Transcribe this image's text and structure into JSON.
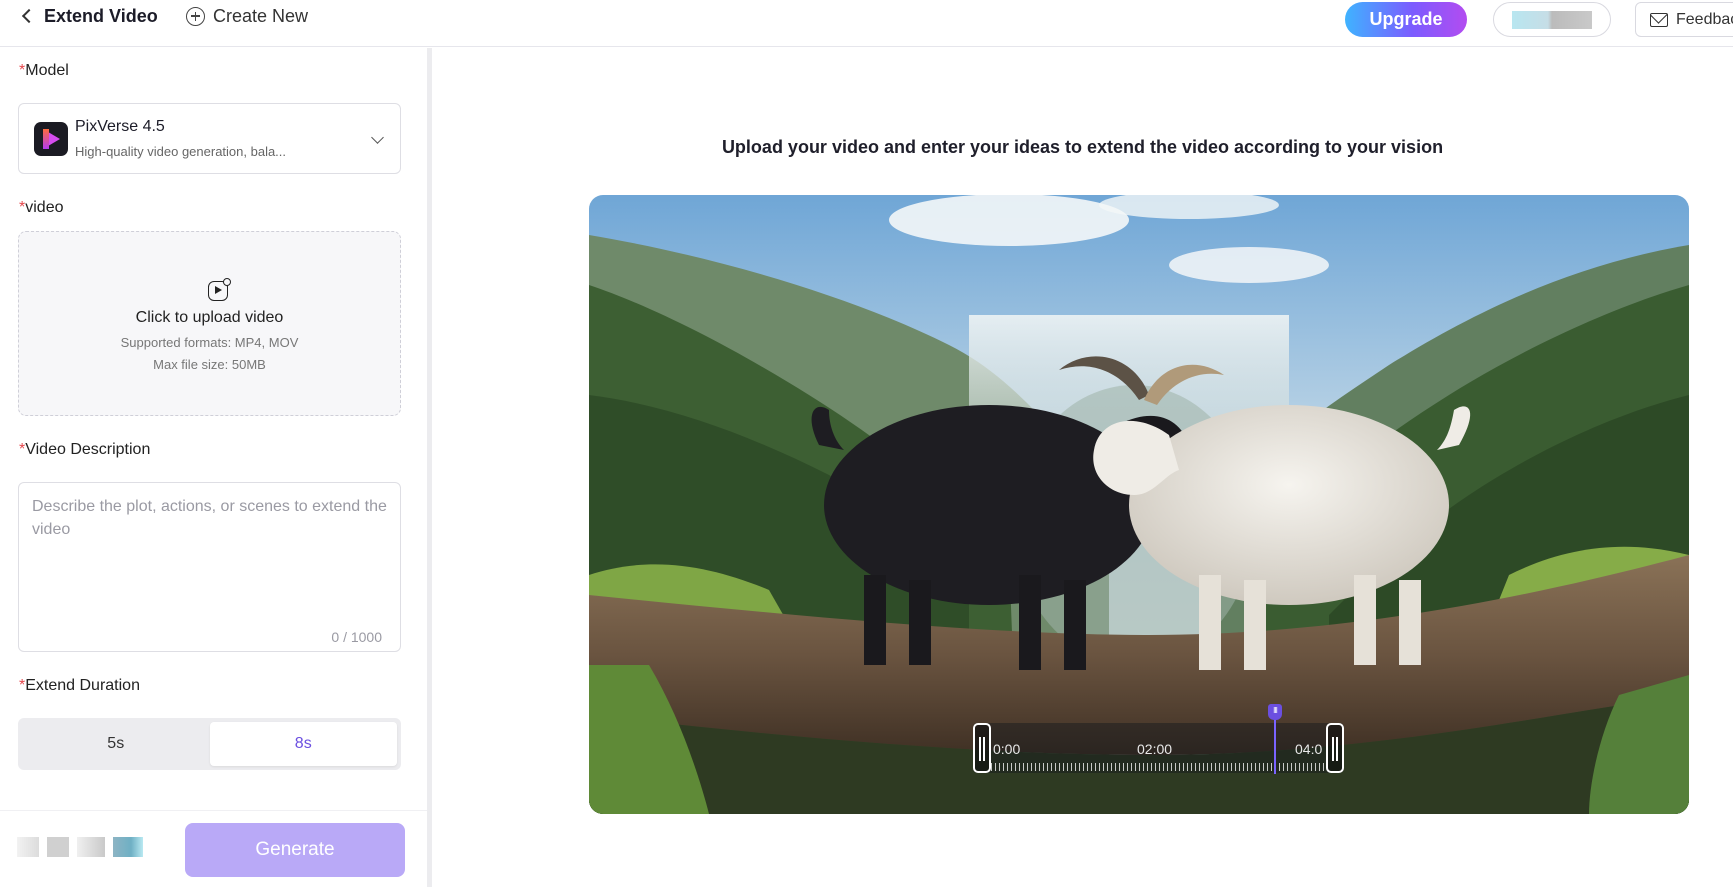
{
  "header": {
    "back_label": "Extend Video",
    "create_new_label": "Create New",
    "upgrade_label": "Upgrade",
    "feedback_label": "Feedback"
  },
  "form": {
    "required_mark": "*",
    "model": {
      "label": "Model",
      "name": "PixVerse 4.5",
      "description": "High-quality video generation, bala..."
    },
    "video": {
      "label": "video",
      "upload_title": "Click to upload video",
      "formats": "Supported formats: MP4, MOV",
      "max_size": "Max file size: 50MB"
    },
    "description": {
      "label": "Video Description",
      "placeholder": "Describe the plot, actions, or scenes to extend the video",
      "value": "",
      "counter": "0 / 1000"
    },
    "duration": {
      "label": "Extend Duration",
      "options": [
        "5s",
        "8s"
      ],
      "selected": "8s"
    },
    "generate_label": "Generate"
  },
  "preview": {
    "headline": "Upload your video and enter your ideas to extend the video according to your vision",
    "timeline": {
      "start": "0:00",
      "mid": "02:00",
      "end": "04:0"
    }
  },
  "colors": {
    "accent": "#6b4fe0",
    "generate_disabled": "#b9a9f7",
    "required": "#e5484d"
  }
}
